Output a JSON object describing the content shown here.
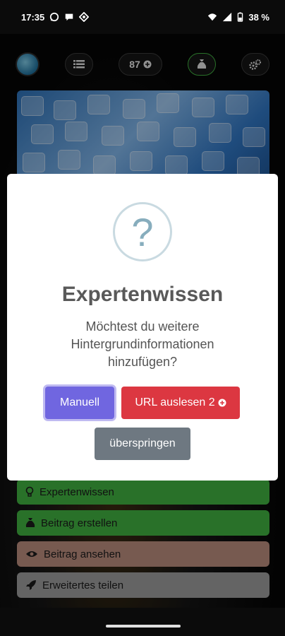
{
  "status_bar": {
    "time": "17:35",
    "battery": "38 %",
    "icons_left": [
      "whatsapp-icon",
      "chat-bubble-icon",
      "binance-icon"
    ],
    "icons_right": [
      "wifi-icon",
      "signal-icon",
      "battery-icon"
    ]
  },
  "top_bar": {
    "credits": "87",
    "credit_icon": "plus-circle-icon",
    "buttons": [
      "avatar",
      "list-icon",
      "credits",
      "money-bag-icon",
      "settings-gears-icon"
    ]
  },
  "modal": {
    "icon": "question-mark-icon",
    "icon_glyph": "?",
    "title": "Expertenwissen",
    "text": "Möchtest du weitere Hintergrundinformationen hinzufügen?",
    "manual_label": "Manuell",
    "url_label": "URL auslesen 2",
    "skip_label": "überspringen"
  },
  "list": {
    "items": [
      {
        "label": "Expertenwissen",
        "icon": "lightbulb-icon",
        "color": "#3fae3f"
      },
      {
        "label": "Beitrag erstellen",
        "icon": "money-bag-icon",
        "color": "#3fae3f"
      },
      {
        "label": "Beitrag ansehen",
        "icon": "eye-icon",
        "color": "#b78a7c"
      },
      {
        "label": "Erweitertes teilen",
        "icon": "rocket-icon",
        "color": "#9a9a9a"
      }
    ]
  },
  "colors": {
    "manual_button": "#7066e0",
    "url_button": "#dc3741",
    "skip_button": "#6e7881"
  }
}
